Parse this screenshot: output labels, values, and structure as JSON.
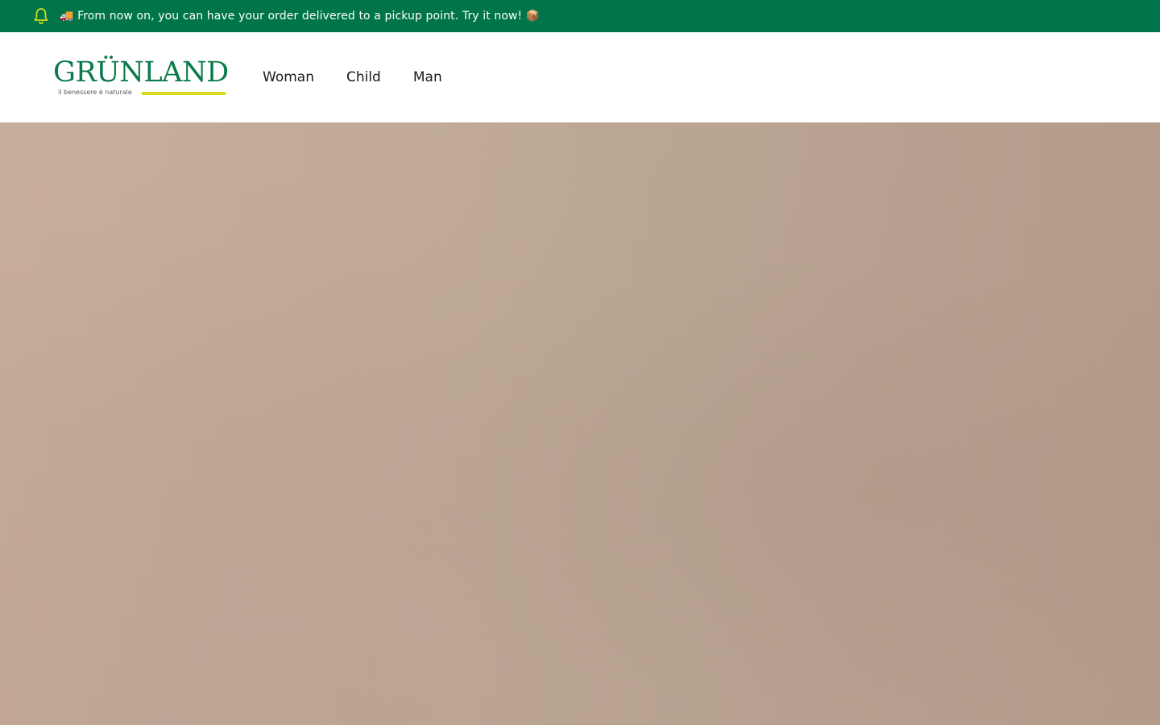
{
  "announcement": {
    "text": "🚚 From now on, you can have your order delivered to a pickup point. Try it now! 📦",
    "icon": "bell-icon",
    "background": "#00754a",
    "icon_color": "#d6dc1c"
  },
  "header": {
    "logo": {
      "wordmark": "GRÜNLAND",
      "tagline": "il benessere è naturale",
      "brand_color": "#0a7a4a",
      "accent_color": "#d6dc1c"
    },
    "nav": {
      "items": [
        {
          "label": "Woman"
        },
        {
          "label": "Child"
        },
        {
          "label": "Man"
        }
      ]
    }
  },
  "hero": {
    "background": "#bea896"
  }
}
